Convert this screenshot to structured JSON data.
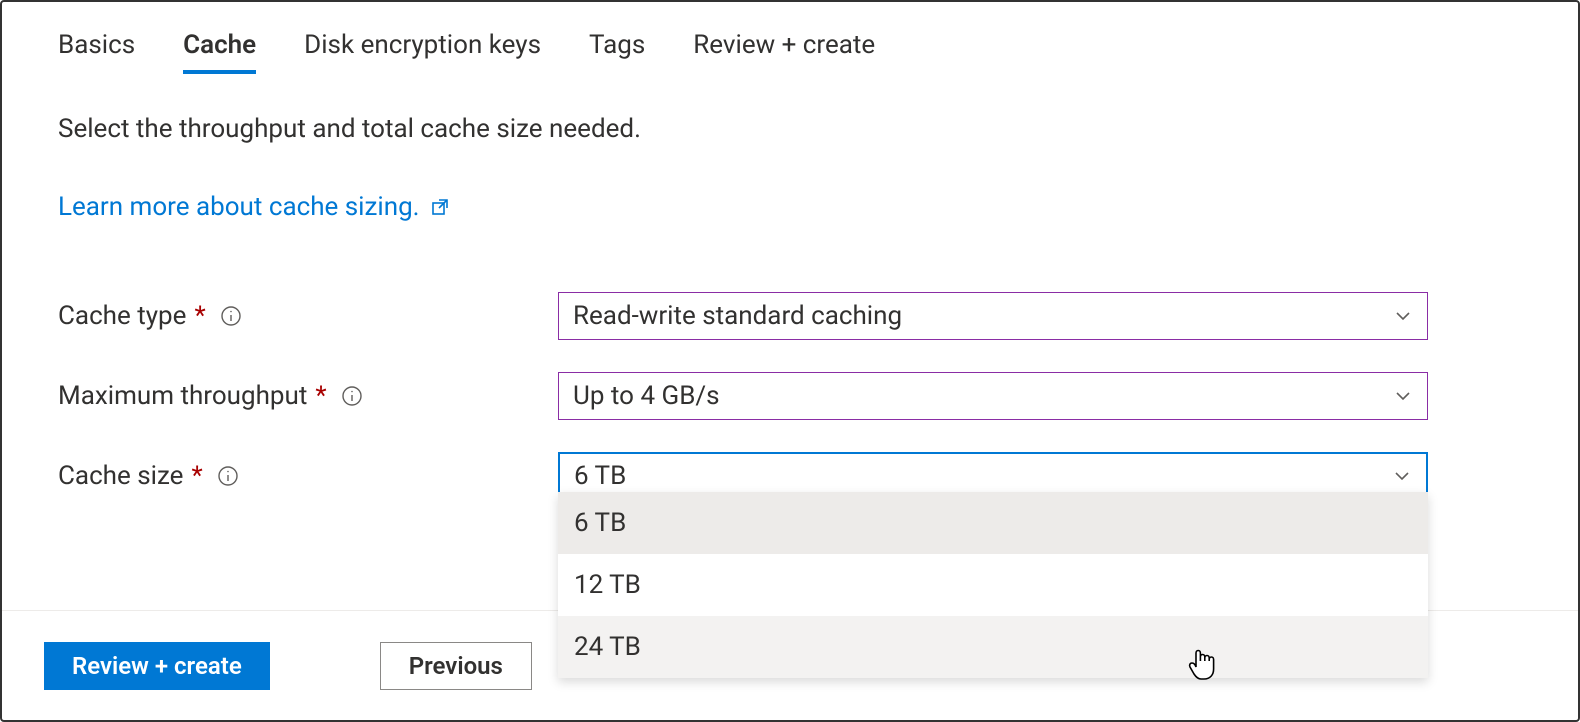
{
  "tabs": {
    "basics": "Basics",
    "cache": "Cache",
    "disk_encryption": "Disk encryption keys",
    "tags": "Tags",
    "review_create": "Review + create"
  },
  "description": "Select the throughput and total cache size needed.",
  "learn_link": "Learn more about cache sizing.",
  "form": {
    "cache_type": {
      "label": "Cache type",
      "value": "Read-write standard caching"
    },
    "max_throughput": {
      "label": "Maximum throughput",
      "value": "Up to 4 GB/s"
    },
    "cache_size": {
      "label": "Cache size",
      "value": "6 TB",
      "options": [
        "6 TB",
        "12 TB",
        "24 TB"
      ]
    }
  },
  "footer": {
    "review_create": "Review + create",
    "previous": "Previous"
  }
}
